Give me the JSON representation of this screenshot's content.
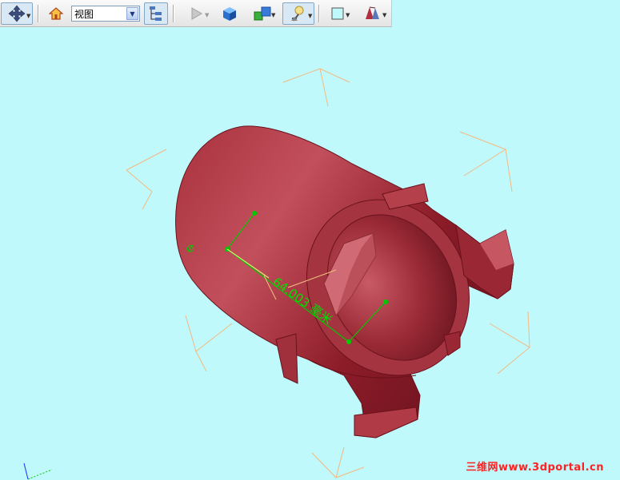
{
  "toolbar": {
    "view_select_value": "视图",
    "icons": [
      "navigate-icon",
      "home-icon",
      "tree-icon",
      "play-icon",
      "cube-icon",
      "multi-cube-icon",
      "lighting-icon",
      "background-color-icon",
      "section-icon"
    ],
    "accent": "#7fa8c8"
  },
  "viewport": {
    "background": "#bff9fb",
    "part_color": "#8e1c27",
    "measure_color": "#00c800",
    "measurement": "64.003 毫米",
    "watermark": "三维网www.3dportal.cn"
  }
}
